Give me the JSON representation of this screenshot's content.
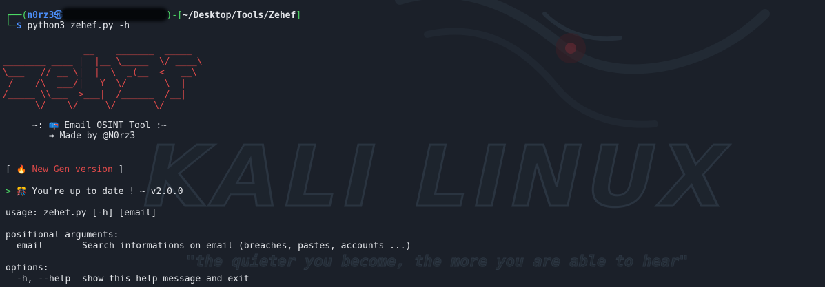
{
  "prompt": {
    "user": "n0rz3",
    "at_symbol": "㉿",
    "path": "~/Desktop/Tools/Zehef",
    "command": "python3 zehef.py -h"
  },
  "banner": {
    "ascii_art": "               __    _______  _____\n________ ____ |  |__ \\_____  \\/ ____\\\n\\___   // __ \\|  |  \\  _(__  <   __\\\n /    /\\  ___/|   Y  \\/       \\  |\n/_____ \\\\___  >___|  /______  /__|\n      \\/    \\/     \\/       \\/",
    "tagline_prefix": "~:",
    "tagline_icon": "envelope-icon",
    "tagline_text": "Email OSINT Tool :~",
    "made_by_arrow": "⇒",
    "made_by_text": "Made by @N0rz3"
  },
  "version_tag": {
    "open": "[",
    "icon": "fire-icon",
    "text": "New Gen version",
    "close": "]"
  },
  "update_status": {
    "prompt": ">",
    "icon": "party-icon",
    "text": "You're up to date ! ~ v2.0.0"
  },
  "help": {
    "usage": "usage: zehef.py [-h] [email]",
    "positional_header": "positional arguments:",
    "positional": [
      {
        "name": "email",
        "description": "Search informations on email (breaches, pastes, accounts ...)"
      }
    ],
    "options_header": "options:",
    "options": [
      {
        "name": "-h, --help",
        "description": "show this help message and exit"
      }
    ]
  },
  "wallpaper": {
    "title": "KALI LINUX",
    "motto": "\"the quieter you become, the more you are able to hear\""
  },
  "colors": {
    "background": "#1b2029",
    "prompt_blue": "#4c8ffb",
    "prompt_green": "#4cd964",
    "banner_red": "#e04a4a",
    "text": "#e2e4e8"
  }
}
